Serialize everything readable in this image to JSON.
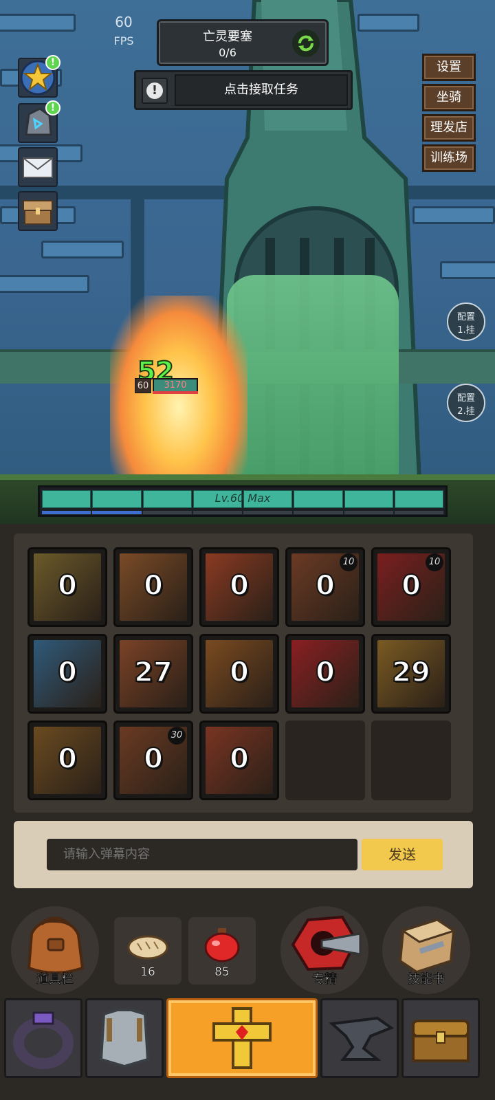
{
  "hud": {
    "fps_value": "60",
    "fps_unit": "FPS",
    "quest_title": "亡灵要塞",
    "quest_progress": "0/6",
    "task_text": "点击接取任务",
    "task_alert_glyph": "!"
  },
  "left_icons": [
    {
      "name": "achievement-star-icon",
      "badge": "!"
    },
    {
      "name": "rune-stone-icon",
      "badge": "!"
    },
    {
      "name": "mail-icon",
      "badge": ""
    },
    {
      "name": "treasure-chest-icon",
      "badge": ""
    }
  ],
  "right_menu": [
    "设置",
    "坐骑",
    "理发店",
    "训练场"
  ],
  "config_buttons": [
    {
      "line1": "配置",
      "line2": "1.挂"
    },
    {
      "line1": "配置",
      "line2": "2.挂"
    }
  ],
  "combat": {
    "damage": "52",
    "enemy_level": "60",
    "enemy_hp": "3170"
  },
  "level_bar": {
    "text": "Lv.60 Max",
    "segments": 8,
    "sub_filled_segments": 2
  },
  "inventory": [
    {
      "count": "0",
      "corner": "",
      "color": "#6b5a2a",
      "icon": "gauntlet-icon"
    },
    {
      "count": "0",
      "corner": "",
      "color": "#7a4a26",
      "icon": "sword-icon"
    },
    {
      "count": "0",
      "corner": "",
      "color": "#8a3a22",
      "icon": "blade-icon"
    },
    {
      "count": "0",
      "corner": "10",
      "color": "#6b3a24",
      "icon": "boot-icon"
    },
    {
      "count": "0",
      "corner": "10",
      "color": "#7a1f1f",
      "icon": "claw-icon"
    },
    {
      "count": "0",
      "corner": "",
      "color": "#2f5a7a",
      "icon": "armor-icon"
    },
    {
      "count": "27",
      "corner": "",
      "color": "#7a4226",
      "icon": "helmet-icon"
    },
    {
      "count": "0",
      "corner": "",
      "color": "#7a4a20",
      "icon": "shield-icon"
    },
    {
      "count": "0",
      "corner": "",
      "color": "#8a1f22",
      "icon": "emblem-icon"
    },
    {
      "count": "29",
      "corner": "",
      "color": "#7a5a22",
      "icon": "medal-icon"
    },
    {
      "count": "0",
      "corner": "",
      "color": "#6a4a20",
      "icon": "fist-icon"
    },
    {
      "count": "0",
      "corner": "30",
      "color": "#6a3a22",
      "icon": "spear-icon"
    },
    {
      "count": "0",
      "corner": "",
      "color": "#7a3422",
      "icon": "crossed-blades-icon"
    }
  ],
  "chat": {
    "placeholder": "请输入弹幕内容",
    "send_label": "发送"
  },
  "actions": {
    "bag_label": "道具栏",
    "bread_count": "16",
    "potion_count": "85",
    "specialty_label": "专精",
    "skillbook_label": "技能书"
  },
  "tabs": [
    {
      "name": "tab-ring",
      "icon": "ring-icon",
      "active": false
    },
    {
      "name": "tab-armor",
      "icon": "chestplate-icon",
      "active": false
    },
    {
      "name": "tab-cross",
      "icon": "golden-cross-icon",
      "active": true
    },
    {
      "name": "tab-anvil",
      "icon": "anvil-icon",
      "active": false
    },
    {
      "name": "tab-chest",
      "icon": "chest-icon",
      "active": false
    }
  ]
}
